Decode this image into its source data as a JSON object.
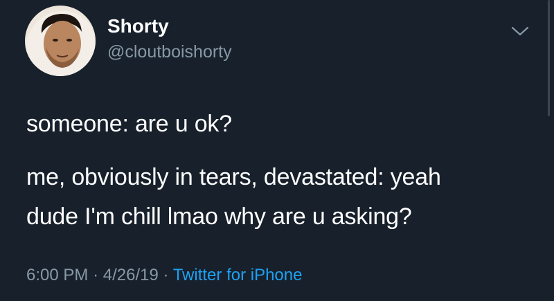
{
  "user": {
    "display_name": "Shorty",
    "handle": "@cloutboishorty"
  },
  "tweet": {
    "lines": [
      "someone: are u ok?",
      "me, obviously in tears, devastated: yeah",
      "dude I'm chill lmao why are u asking?"
    ]
  },
  "meta": {
    "time": "6:00 PM",
    "separator": "·",
    "date": "4/26/19",
    "source": "Twitter for iPhone"
  },
  "icons": {
    "menu": "chevron-down-icon"
  },
  "colors": {
    "background": "#17202b",
    "text": "#ffffff",
    "secondary_text": "#8899a6",
    "link": "#1da1f2"
  }
}
